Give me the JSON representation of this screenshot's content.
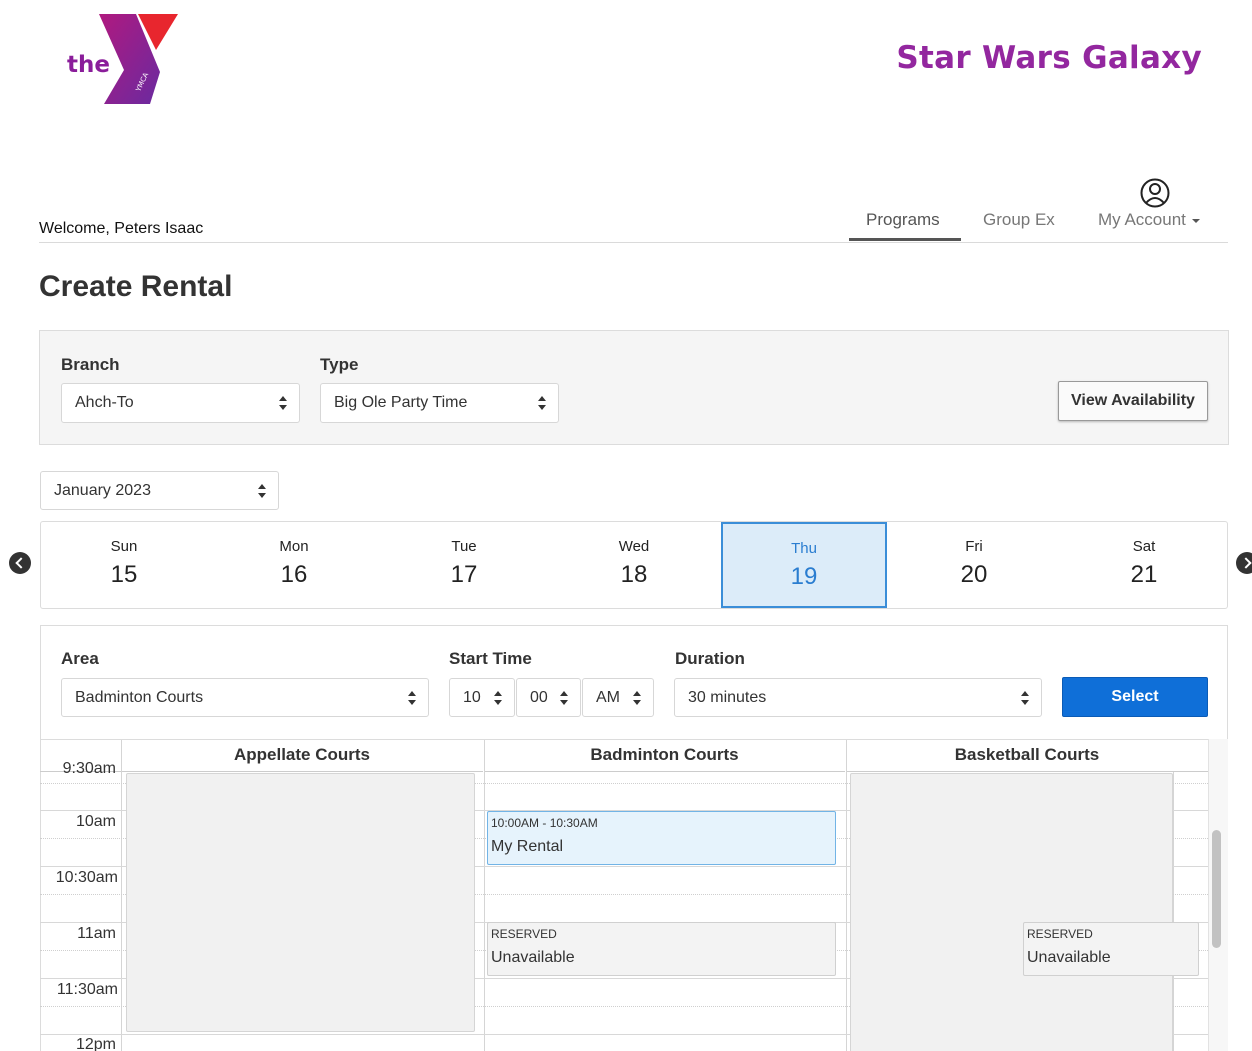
{
  "header": {
    "logo_text": "the",
    "logo_mark_text": "YMCA",
    "brand_title": "Star Wars Galaxy",
    "welcome": "Welcome, Peters Isaac",
    "nav": [
      "Programs",
      "Group Ex",
      "My Account"
    ],
    "active_nav": "Programs"
  },
  "page_title": "Create Rental",
  "filters": {
    "branch_label": "Branch",
    "branch_value": "Ahch-To",
    "type_label": "Type",
    "type_value": "Big Ole Party Time",
    "view_button": "View Availability"
  },
  "calendar": {
    "month_value": "January 2023",
    "days": [
      {
        "name": "Sun",
        "num": "15"
      },
      {
        "name": "Mon",
        "num": "16"
      },
      {
        "name": "Tue",
        "num": "17"
      },
      {
        "name": "Wed",
        "num": "18"
      },
      {
        "name": "Thu",
        "num": "19"
      },
      {
        "name": "Fri",
        "num": "20"
      },
      {
        "name": "Sat",
        "num": "21"
      }
    ],
    "selected_day": "Thu"
  },
  "booking": {
    "area_label": "Area",
    "area_value": "Badminton Courts",
    "start_label": "Start Time",
    "hour_value": "10",
    "minute_value": "00",
    "ampm_value": "AM",
    "duration_label": "Duration",
    "duration_value": "30 minutes",
    "select_button": "Select"
  },
  "schedule": {
    "columns": [
      "Appellate Courts",
      "Badminton Courts",
      "Basketball Courts"
    ],
    "times": [
      "9:30am",
      "10am",
      "10:30am",
      "11am",
      "11:30am",
      "12pm"
    ],
    "events": [
      {
        "range": "10:00AM - 10:30AM",
        "title": "My Rental"
      },
      {
        "range": "RESERVED",
        "title": "Unavailable"
      },
      {
        "range": "RESERVED",
        "title": "Unavailable"
      }
    ]
  },
  "colors": {
    "brand": "#93279f",
    "primary_button": "#0f6fd8",
    "selected_day_bg": "#dcecf9",
    "selected_day_text": "#2a7dd0"
  }
}
